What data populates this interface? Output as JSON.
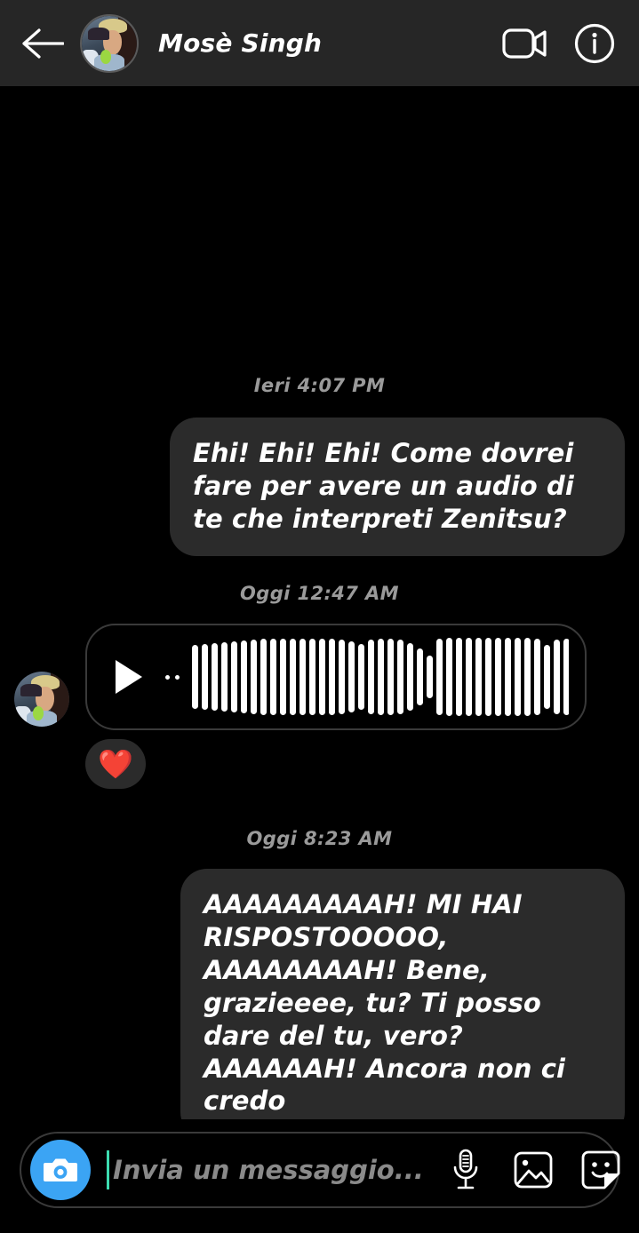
{
  "header": {
    "back_icon": "back-arrow-icon",
    "avatar_alt": "profile-photo",
    "name": "Mosè Singh",
    "video_icon": "video-call-icon",
    "info_icon": "info-icon"
  },
  "thread": {
    "items": [
      {
        "type": "timestamp",
        "text": "Ieri 4:07 PM"
      },
      {
        "type": "message",
        "side": "right",
        "text": "Ehi! Ehi! Ehi! Come dovrei fare per avere un audio di te che interpreti Zenitsu?"
      },
      {
        "type": "timestamp",
        "text": "Oggi 12:47 AM"
      },
      {
        "type": "voice",
        "side": "left",
        "play_icon": "play-icon",
        "waveform_bars": [
          72,
          74,
          76,
          78,
          80,
          82,
          84,
          86,
          86,
          86,
          86,
          86,
          86,
          86,
          86,
          84,
          80,
          74,
          84,
          86,
          86,
          84,
          76,
          64,
          48,
          86,
          88,
          88,
          88,
          88,
          88,
          88,
          88,
          88,
          88,
          86,
          72,
          84,
          86,
          86,
          86,
          66,
          86,
          88,
          88,
          82,
          88,
          88,
          88,
          88
        ],
        "reaction": "❤️"
      },
      {
        "type": "timestamp",
        "text": "Oggi 8:23 AM"
      },
      {
        "type": "message",
        "side": "right",
        "text": "AAAAAAAAAH! MI HAI RISPOSTOOOOO, AAAAAAAAH! Bene, grazieeee, tu? Ti posso dare del tu, vero? AAAAAAH! Ancora non ci credo"
      }
    ]
  },
  "composer": {
    "camera_icon": "camera-icon",
    "placeholder": "Invia un messaggio...",
    "input_value": "",
    "mic_icon": "microphone-icon",
    "gallery_icon": "image-icon",
    "sticker_icon": "sticker-icon"
  },
  "colors": {
    "background": "#000000",
    "header_bg": "#262626",
    "bubble_bg": "#2b2b2b",
    "accent_blue": "#3ba4f4",
    "timestamp_text": "#9a9a9a",
    "caret": "#3ddbb0",
    "heart": "#ff3b3b"
  }
}
